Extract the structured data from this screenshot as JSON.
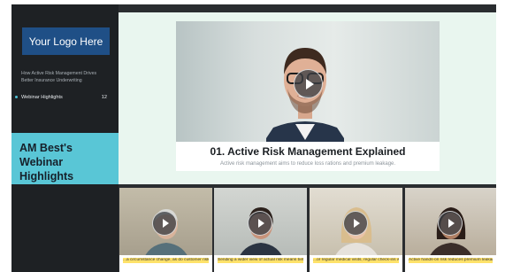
{
  "sidebar": {
    "logo_text": "Your Logo Here",
    "description": "How Active Risk Management Drives Better Insurance Underwriting",
    "items": [
      {
        "label": "Webinar Highlights",
        "count": "12"
      }
    ],
    "banner": {
      "line1": "AM Best's",
      "line2": "Webinar Highlights"
    }
  },
  "featured": {
    "title": "01. Active Risk Management Explained",
    "subtitle": "Active risk management aims to reduce loss rations and premium leakage."
  },
  "thumbnails": [
    {
      "caption": "...a circumstance change, as do customer risk aspects"
    },
    {
      "caption": "Sending a wider view of actual risk means better risk pricing, which benefits everyone"
    },
    {
      "caption": "...or regular medical visits, regular check-ins with customers place on for great health and insurance"
    },
    {
      "caption": "Active hands-on risk reduces premium leakage, which... for the costs of an active risk management program"
    }
  ],
  "colors": {
    "accent": "#59c6d6",
    "logo_bg": "#1f4f86",
    "sidebar_bg": "#1e2124",
    "main_bg": "#e9f6ef",
    "highlight": "#ffe26a"
  },
  "icons": [
    "play-icon"
  ]
}
